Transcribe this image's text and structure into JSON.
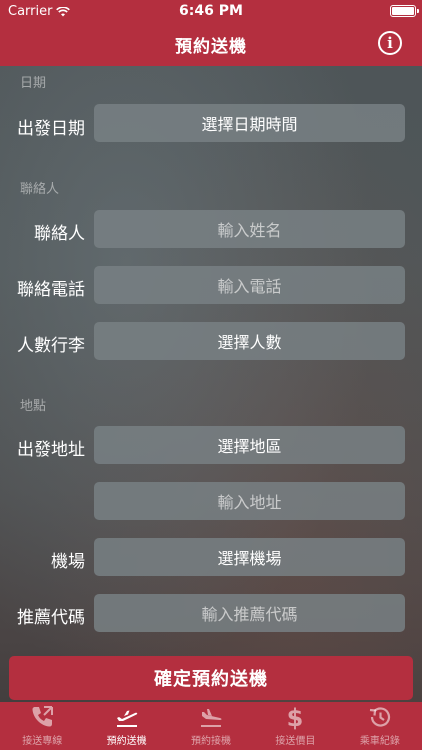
{
  "status_bar": {
    "carrier": "Carrier",
    "time": "6:46 PM",
    "battery_level": 1.0
  },
  "nav": {
    "title": "預約送機",
    "info_label": "i"
  },
  "sections": {
    "date": "日期",
    "contact": "聯絡人",
    "address": "地點"
  },
  "rows": {
    "departure_date": {
      "label": "出發日期",
      "value": "選擇日期時間"
    },
    "contact_name": {
      "label": "聯絡人",
      "placeholder": "輸入姓名"
    },
    "contact_phone": {
      "label": "聯絡電話",
      "placeholder": "輸入電話"
    },
    "passengers": {
      "label": "人數行李",
      "value": "選擇人數"
    },
    "departure_address": {
      "label": "出發地址",
      "region_value": "選擇地區",
      "address_placeholder": "輸入地址"
    },
    "airport": {
      "label": "機場",
      "value": "選擇機場"
    },
    "referral_code": {
      "label": "推薦代碼",
      "placeholder": "輸入推薦代碼"
    }
  },
  "confirm_button": "確定預約送機",
  "tabs": [
    {
      "label": "接送專線",
      "icon": "phone-icon",
      "active": false
    },
    {
      "label": "預約送機",
      "icon": "plane-departure-icon",
      "active": true
    },
    {
      "label": "預約接機",
      "icon": "plane-arrival-icon",
      "active": false
    },
    {
      "label": "接送價目",
      "icon": "dollar-icon",
      "active": false
    },
    {
      "label": "乘車紀錄",
      "icon": "history-icon",
      "active": false
    }
  ],
  "colors": {
    "brand": "#b42f3f",
    "field": "#7a8185"
  }
}
